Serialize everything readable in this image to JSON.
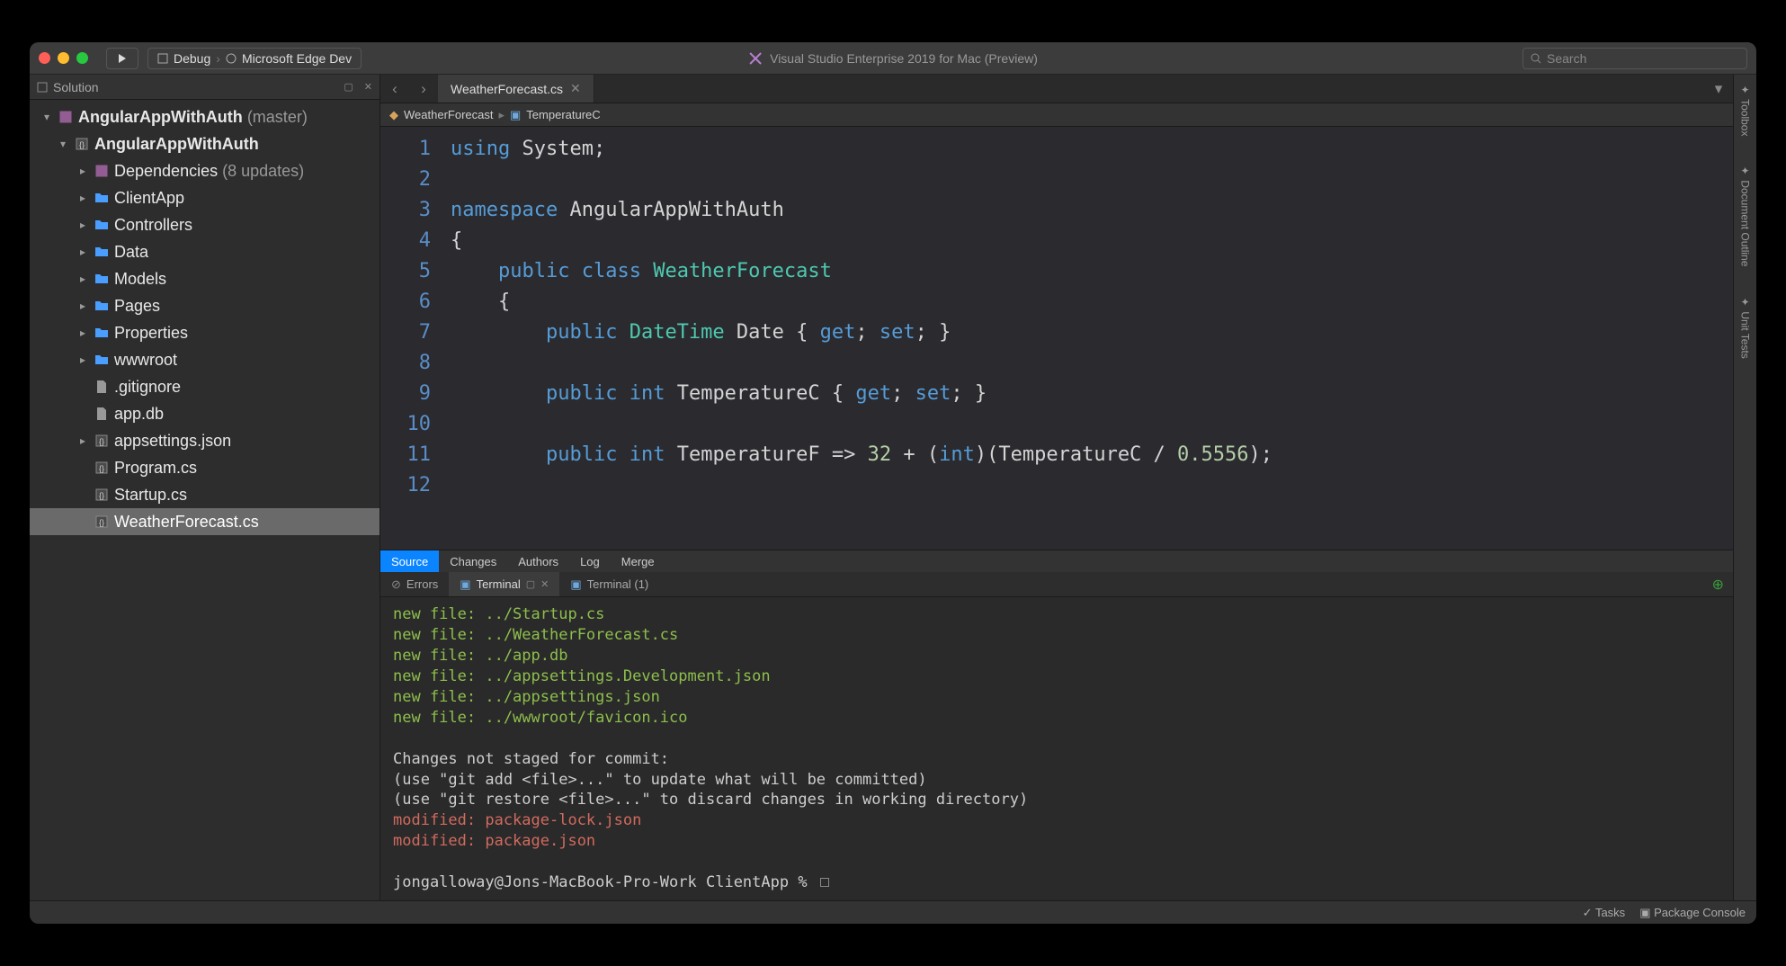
{
  "titlebar": {
    "config_target": "Debug",
    "config_browser": "Microsoft Edge Dev",
    "app_title": "Visual Studio Enterprise 2019 for Mac (Preview)",
    "search_placeholder": "Search"
  },
  "sidebar": {
    "panel_title": "Solution",
    "root_name": "AngularAppWithAuth",
    "root_branch": "(master)",
    "project_name": "AngularAppWithAuth",
    "deps_label": "Dependencies",
    "deps_badge": "(8 updates)",
    "folders": [
      "ClientApp",
      "Controllers",
      "Data",
      "Models",
      "Pages",
      "Properties",
      "wwwroot"
    ],
    "files": [
      {
        "name": ".gitignore",
        "type": "txt"
      },
      {
        "name": "app.db",
        "type": "txt"
      },
      {
        "name": "appsettings.json",
        "type": "json",
        "expandable": true
      },
      {
        "name": "Program.cs",
        "type": "cs"
      },
      {
        "name": "Startup.cs",
        "type": "cs"
      },
      {
        "name": "WeatherForecast.cs",
        "type": "cs",
        "selected": true
      }
    ]
  },
  "righttabs": [
    "Toolbox",
    "Document Outline",
    "Unit Tests"
  ],
  "editor_tab": "WeatherForecast.cs",
  "breadcrumb": {
    "class": "WeatherForecast",
    "member": "TemperatureC"
  },
  "code": {
    "line_count": 12,
    "tokens": [
      [
        [
          "kw",
          "using"
        ],
        [
          "punct",
          " "
        ],
        [
          "ident",
          "System"
        ],
        [
          "punct",
          ";"
        ]
      ],
      [],
      [
        [
          "kw",
          "namespace"
        ],
        [
          "punct",
          " "
        ],
        [
          "ident",
          "AngularAppWithAuth"
        ]
      ],
      [
        [
          "punct",
          "{"
        ]
      ],
      [
        [
          "punct",
          "    "
        ],
        [
          "kw",
          "public"
        ],
        [
          "punct",
          " "
        ],
        [
          "kw",
          "class"
        ],
        [
          "punct",
          " "
        ],
        [
          "type",
          "WeatherForecast"
        ]
      ],
      [
        [
          "punct",
          "    {"
        ]
      ],
      [
        [
          "punct",
          "        "
        ],
        [
          "kw",
          "public"
        ],
        [
          "punct",
          " "
        ],
        [
          "type",
          "DateTime"
        ],
        [
          "punct",
          " "
        ],
        [
          "ident",
          "Date"
        ],
        [
          "punct",
          " { "
        ],
        [
          "kw",
          "get"
        ],
        [
          "punct",
          "; "
        ],
        [
          "kw",
          "set"
        ],
        [
          "punct",
          "; }"
        ]
      ],
      [],
      [
        [
          "punct",
          "        "
        ],
        [
          "kw",
          "public"
        ],
        [
          "punct",
          " "
        ],
        [
          "kw",
          "int"
        ],
        [
          "punct",
          " "
        ],
        [
          "ident",
          "TemperatureC"
        ],
        [
          "punct",
          " { "
        ],
        [
          "kw",
          "get"
        ],
        [
          "punct",
          "; "
        ],
        [
          "kw",
          "set"
        ],
        [
          "punct",
          "; }"
        ]
      ],
      [],
      [
        [
          "punct",
          "        "
        ],
        [
          "kw",
          "public"
        ],
        [
          "punct",
          " "
        ],
        [
          "kw",
          "int"
        ],
        [
          "punct",
          " "
        ],
        [
          "ident",
          "TemperatureF"
        ],
        [
          "punct",
          " => "
        ],
        [
          "num",
          "32"
        ],
        [
          "punct",
          " + ("
        ],
        [
          "kw",
          "int"
        ],
        [
          "punct",
          ")(TemperatureC / "
        ],
        [
          "num",
          "0.5556"
        ],
        [
          "punct",
          ");"
        ]
      ],
      []
    ]
  },
  "sourcebar": [
    "Source",
    "Changes",
    "Authors",
    "Log",
    "Merge"
  ],
  "bottom_tabs": {
    "errors": "Errors",
    "terminal": "Terminal",
    "terminal2": "Terminal (1)"
  },
  "terminal_lines": [
    {
      "cls": "g",
      "text": "        new file:   ../Startup.cs"
    },
    {
      "cls": "g",
      "text": "        new file:   ../WeatherForecast.cs"
    },
    {
      "cls": "g",
      "text": "        new file:   ../app.db"
    },
    {
      "cls": "g",
      "text": "        new file:   ../appsettings.Development.json"
    },
    {
      "cls": "g",
      "text": "        new file:   ../appsettings.json"
    },
    {
      "cls": "g",
      "text": "        new file:   ../wwwroot/favicon.ico"
    },
    {
      "cls": "w",
      "text": ""
    },
    {
      "cls": "w",
      "text": "Changes not staged for commit:"
    },
    {
      "cls": "w",
      "text": "  (use \"git add <file>...\" to update what will be committed)"
    },
    {
      "cls": "w",
      "text": "  (use \"git restore <file>...\" to discard changes in working directory)"
    },
    {
      "cls": "r",
      "text": "        modified:   package-lock.json"
    },
    {
      "cls": "r",
      "text": "        modified:   package.json"
    },
    {
      "cls": "w",
      "text": ""
    }
  ],
  "prompt": "jongalloway@Jons-MacBook-Pro-Work ClientApp % ",
  "status": {
    "tasks": "Tasks",
    "pkg": "Package Console"
  }
}
